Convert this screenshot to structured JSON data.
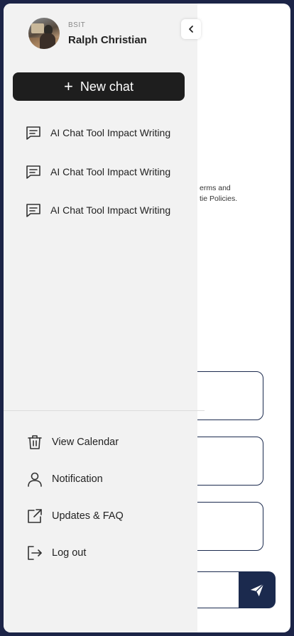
{
  "background": {
    "terms_line_1": "erms and",
    "terms_line_2": "tie Policies."
  },
  "profile": {
    "program": "BSIT",
    "name": "Ralph Christian"
  },
  "new_chat_label": "New chat",
  "chats": [
    {
      "title": "AI Chat Tool Impact Writing"
    },
    {
      "title": "AI Chat Tool Impact Writing"
    },
    {
      "title": "AI Chat Tool Impact Writing"
    }
  ],
  "menu": [
    {
      "label": "View Calendar",
      "icon": "trash-icon"
    },
    {
      "label": "Notification",
      "icon": "user-icon"
    },
    {
      "label": "Updates & FAQ",
      "icon": "external-link-icon"
    },
    {
      "label": "Log out",
      "icon": "logout-icon"
    }
  ],
  "colors": {
    "frame": "#1c2447",
    "drawer": "#f2f2f2",
    "new_chat_bg": "#1e1e1e",
    "accent": "#1b2a4e"
  }
}
